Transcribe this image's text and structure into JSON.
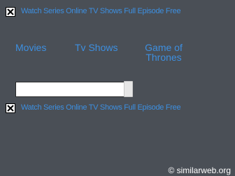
{
  "banners": {
    "top": {
      "icon": "broken-image-icon",
      "alt_text": "Watch Series Online TV Shows Full Episode Free"
    },
    "bottom": {
      "icon": "broken-image-icon",
      "alt_text": "Watch Series Online TV Shows Full Episode Free"
    }
  },
  "nav": {
    "movies": "Movies",
    "tv_shows": "Tv Shows",
    "game_of_thrones_line1": "Game of",
    "game_of_thrones_line2": "Thrones"
  },
  "search": {
    "value": "",
    "placeholder": ""
  },
  "watermark": "© similarweb.org",
  "colors": {
    "background": "#4a4f56",
    "link": "#3d8fe0"
  }
}
